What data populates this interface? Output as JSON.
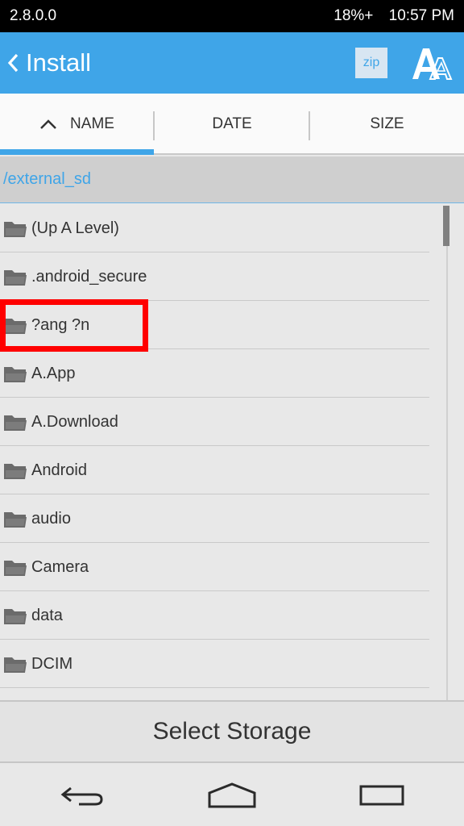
{
  "status_bar": {
    "version": "2.8.0.0",
    "battery": "18%+",
    "time": "10:57 PM"
  },
  "app_bar": {
    "title": "Install",
    "zip_label": "zip",
    "icons": [
      "chevron-left-icon",
      "zip-icon",
      "font-size-icon"
    ],
    "color": "#3fa5e8"
  },
  "sort_bar": {
    "tabs": [
      {
        "label": "NAME",
        "active": true,
        "sort_direction": "ascending"
      },
      {
        "label": "DATE",
        "active": false
      },
      {
        "label": "SIZE",
        "active": false
      }
    ]
  },
  "path": "/external_sd",
  "files": [
    {
      "name": "(Up A Level)",
      "icon": "folder-icon"
    },
    {
      "name": ".android_secure",
      "icon": "folder-icon"
    },
    {
      "name": "?ang ?n",
      "icon": "folder-icon",
      "highlighted": true
    },
    {
      "name": "A.App",
      "icon": "folder-icon"
    },
    {
      "name": "A.Download",
      "icon": "folder-icon"
    },
    {
      "name": "Android",
      "icon": "folder-icon"
    },
    {
      "name": "audio",
      "icon": "folder-icon"
    },
    {
      "name": "Camera",
      "icon": "folder-icon"
    },
    {
      "name": "data",
      "icon": "folder-icon"
    },
    {
      "name": "DCIM",
      "icon": "folder-icon"
    }
  ],
  "select_storage_label": "Select Storage",
  "nav_bar": {
    "icons": [
      "back-icon",
      "home-icon",
      "recents-icon"
    ]
  },
  "highlight_color": "#ff0000"
}
